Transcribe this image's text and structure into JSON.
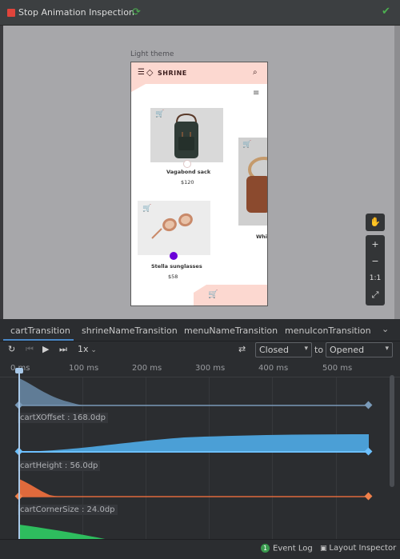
{
  "window": {
    "title": "Stop Animation Inspection",
    "refresh_icon": "refresh-icon",
    "confirm_icon": "check-icon"
  },
  "preview": {
    "theme_label": "Light theme",
    "app": {
      "brand": "SHRINE",
      "products": [
        {
          "name": "Vagabond sack",
          "price": "$120"
        },
        {
          "name": "Stella sunglasses",
          "price": "$58"
        },
        {
          "name": "Whit",
          "price": ""
        }
      ]
    },
    "toolbox": {
      "pan": "✋",
      "zoom_in": "+",
      "zoom_out": "−",
      "actual_size": "1:1",
      "fit": "⤢"
    }
  },
  "tabs": [
    {
      "label": "cartTransition",
      "active": true
    },
    {
      "label": "shrineNameTransition",
      "active": false
    },
    {
      "label": "menuNameTransition",
      "active": false
    },
    {
      "label": "menuIconTransition",
      "active": false
    }
  ],
  "controls": {
    "speed": "1x",
    "from_state": "Closed",
    "to_label": "to",
    "to_state": "Opened"
  },
  "timeline": {
    "ticks": [
      "0 ms",
      "100 ms",
      "200 ms",
      "300 ms",
      "400 ms",
      "500 ms"
    ],
    "properties": [
      {
        "label": "cartXOffset : 168.0dp"
      },
      {
        "label": "cartHeight : 56.0dp"
      },
      {
        "label": "cartCornerSize : 24.0dp"
      }
    ],
    "colors": {
      "track1": "#6a8ba8",
      "track2": "#4b9fd6",
      "track3": "#e06a3c",
      "track4": "#2ebd5e",
      "playhead": "#a8c8e8"
    }
  },
  "statusbar": {
    "event_count": "1",
    "event_log": "Event Log",
    "layout_inspector": "Layout Inspector"
  }
}
